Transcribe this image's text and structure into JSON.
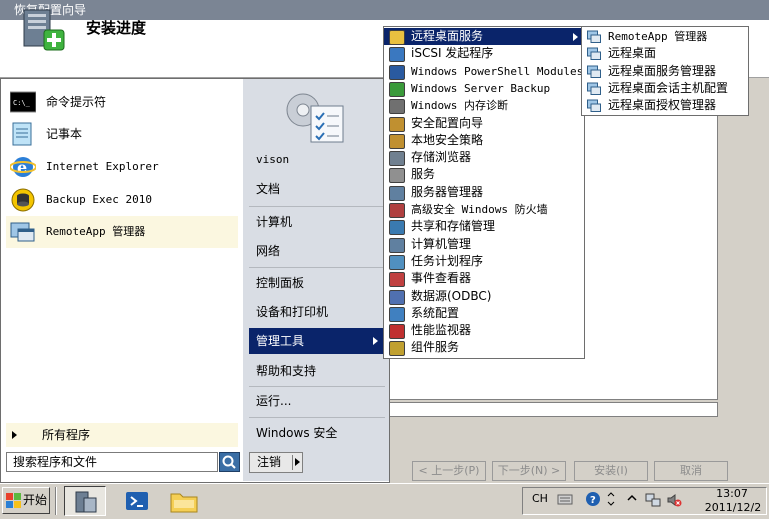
{
  "wizard": {
    "window_title": "恢复配置向导",
    "header_title": "安装进度",
    "buttons": {
      "back": "< 上一步(P)",
      "next": "下一步(N) >",
      "install": "安装(I)",
      "cancel": "取消"
    }
  },
  "start_menu": {
    "pinned": [
      {
        "label": "命令提示符",
        "icon": "cmd-icon"
      },
      {
        "label": "记事本",
        "icon": "notepad-icon"
      },
      {
        "label": "Internet Explorer",
        "icon": "ie-icon"
      },
      {
        "label": "Backup Exec 2010",
        "icon": "backup-exec-icon"
      },
      {
        "label": "RemoteApp 管理器",
        "icon": "remoteapp-icon"
      }
    ],
    "all_programs": "所有程序",
    "search_placeholder": "搜索程序和文件",
    "right": {
      "user": "vison",
      "documents": "文档",
      "computer": "计算机",
      "network": "网络",
      "control_panel": "控制面板",
      "devices": "设备和打印机",
      "admin_tools": "管理工具",
      "help": "帮助和支持",
      "run": "运行...",
      "windows_security": "Windows 安全"
    },
    "logoff": "注销"
  },
  "admin_tools_menu": {
    "items": [
      {
        "label": "远程桌面服务",
        "icon": "folder-icon",
        "color": "#e8c040"
      },
      {
        "label": "iSCSI 发起程序",
        "icon": "iscsi-icon",
        "color": "#3a78c0"
      },
      {
        "label": "Windows PowerShell Modules",
        "icon": "powershell-icon",
        "color": "#2a5aa0"
      },
      {
        "label": "Windows Server Backup",
        "icon": "backup-icon",
        "color": "#3a9a3a"
      },
      {
        "label": "Windows 内存诊断",
        "icon": "memory-icon",
        "color": "#707070"
      },
      {
        "label": "安全配置向导",
        "icon": "security-wizard-icon",
        "color": "#c09030"
      },
      {
        "label": "本地安全策略",
        "icon": "security-policy-icon",
        "color": "#c09030"
      },
      {
        "label": "存储浏览器",
        "icon": "storage-icon",
        "color": "#708090"
      },
      {
        "label": "服务",
        "icon": "services-icon",
        "color": "#909090"
      },
      {
        "label": "服务器管理器",
        "icon": "server-manager-icon",
        "color": "#6080a0"
      },
      {
        "label": "高级安全 Windows 防火墙",
        "icon": "firewall-icon",
        "color": "#b04040"
      },
      {
        "label": "共享和存储管理",
        "icon": "share-storage-icon",
        "color": "#3a7ab0"
      },
      {
        "label": "计算机管理",
        "icon": "computer-management-icon",
        "color": "#6080a0"
      },
      {
        "label": "任务计划程序",
        "icon": "task-scheduler-icon",
        "color": "#5090c0"
      },
      {
        "label": "事件查看器",
        "icon": "event-viewer-icon",
        "color": "#c04040"
      },
      {
        "label": "数据源(ODBC)",
        "icon": "odbc-icon",
        "color": "#5070b0"
      },
      {
        "label": "系统配置",
        "icon": "system-config-icon",
        "color": "#4080c0"
      },
      {
        "label": "性能监视器",
        "icon": "performance-icon",
        "color": "#c03030"
      },
      {
        "label": "组件服务",
        "icon": "component-services-icon",
        "color": "#c0a030"
      }
    ]
  },
  "rds_menu": {
    "items": [
      {
        "label": "RemoteApp 管理器",
        "icon": "remoteapp-icon"
      },
      {
        "label": "远程桌面",
        "icon": "remote-desktop-icon"
      },
      {
        "label": "远程桌面服务管理器",
        "icon": "rds-manager-icon"
      },
      {
        "label": "远程桌面会话主机配置",
        "icon": "rdsh-config-icon"
      },
      {
        "label": "远程桌面授权管理器",
        "icon": "licensing-icon"
      }
    ]
  },
  "taskbar": {
    "start_label": "开始",
    "ime": "CH",
    "clock_time": "13:07",
    "clock_date": "2011/12/2"
  }
}
